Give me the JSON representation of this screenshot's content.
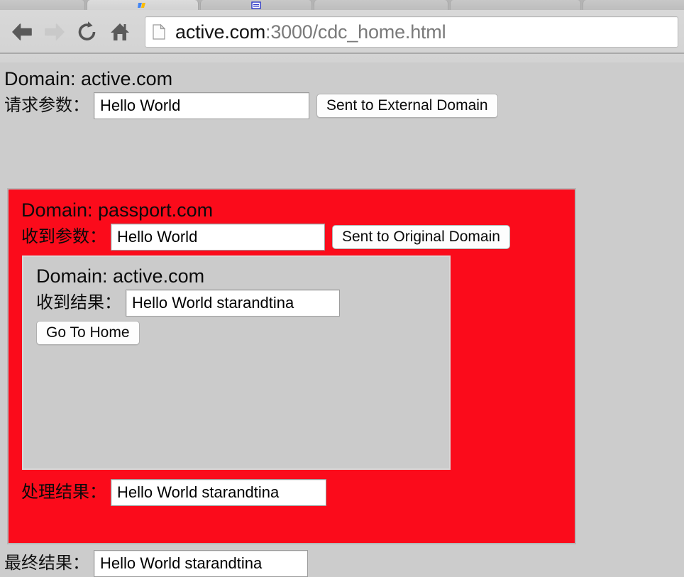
{
  "browser": {
    "tabs": [
      {
        "name": "tab-partial-left",
        "favicon": "none"
      },
      {
        "name": "tab-google",
        "favicon": "google-icon"
      },
      {
        "name": "tab-document",
        "favicon": "document-icon"
      },
      {
        "name": "tab-plain",
        "favicon": "none"
      },
      {
        "name": "tab-plain-2",
        "favicon": "none"
      },
      {
        "name": "tab-plain-3",
        "favicon": "none"
      }
    ],
    "nav": {
      "back_label": "Back",
      "back_icon": "arrow-left-icon",
      "forward_label": "Forward",
      "forward_icon": "arrow-right-icon",
      "reload_label": "Reload",
      "reload_icon": "reload-icon",
      "home_label": "Home",
      "home_icon": "home-icon"
    },
    "omnibox": {
      "page_icon": "page-document-icon",
      "url_host": "active.com",
      "url_path": ":3000/cdc_home.html",
      "url_full": "active.com:3000/cdc_home.html"
    }
  },
  "top_level": {
    "domain_heading": "Domain: active.com",
    "request_label": "请求参数：",
    "request_value": "Hello World",
    "send_button_label": "Sent to External Domain"
  },
  "outer_frame": {
    "domain_heading": "Domain: passport.com",
    "received_label": "收到参数：",
    "received_value": "Hello World",
    "send_button_label": "Sent to Original Domain",
    "processed_label": "处理结果：",
    "processed_value": "Hello World starandtina",
    "background_color": "#fb0b1b"
  },
  "inner_frame": {
    "domain_heading": "Domain: active.com",
    "result_label": "收到结果：",
    "result_value": "Hello World starandtina",
    "home_button_label": "Go To Home",
    "background_color": "#cbcbcb"
  },
  "final": {
    "label": "最终结果：",
    "value": "Hello World starandtina"
  }
}
